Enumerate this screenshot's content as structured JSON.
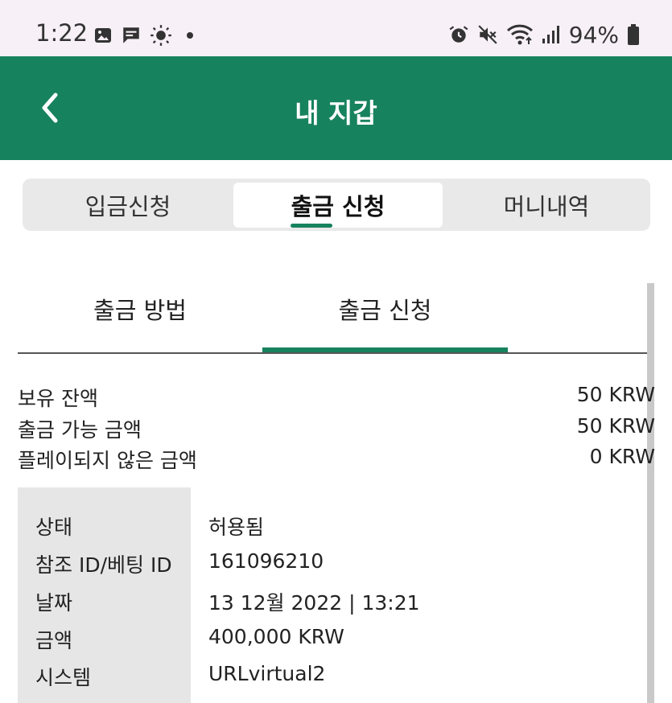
{
  "status_bar": {
    "time": "1:22",
    "battery": "94%",
    "left_icons": [
      "image-icon",
      "message-icon",
      "brightness-icon",
      "dot-icon"
    ],
    "right_icons": [
      "alarm-icon",
      "mute-icon",
      "wifi-icon",
      "signal-icon",
      "battery-icon"
    ]
  },
  "header": {
    "title": "내 지갑"
  },
  "segment_tabs": [
    {
      "label": "입금신청",
      "active": false
    },
    {
      "label": "출금 신청",
      "active": true
    },
    {
      "label": "머니내역",
      "active": false
    }
  ],
  "sub_tabs": [
    {
      "label": "출금 방법",
      "active": false
    },
    {
      "label": "출금 신청",
      "active": true
    }
  ],
  "balances": [
    {
      "label": "보유 잔액",
      "value": "50 KRW"
    },
    {
      "label": "출금 가능 금액",
      "value": "50 KRW"
    },
    {
      "label": "플레이되지 않은 금액",
      "value": "0 KRW"
    }
  ],
  "detail": [
    {
      "label": "상태",
      "value": "허용됨"
    },
    {
      "label": "참조 ID/베팅 ID",
      "value": "161096210"
    },
    {
      "label": "날짜",
      "value": "13 12월 2022 | 13:21"
    },
    {
      "label": "금액",
      "value": "400,000 KRW"
    },
    {
      "label": "시스템",
      "value": "URLvirtual2"
    }
  ],
  "colors": {
    "brand": "#17825e",
    "status_bg": "#f7f0f7",
    "segment_bg": "#e9e9e9",
    "label_bg": "#e6e6e6"
  }
}
